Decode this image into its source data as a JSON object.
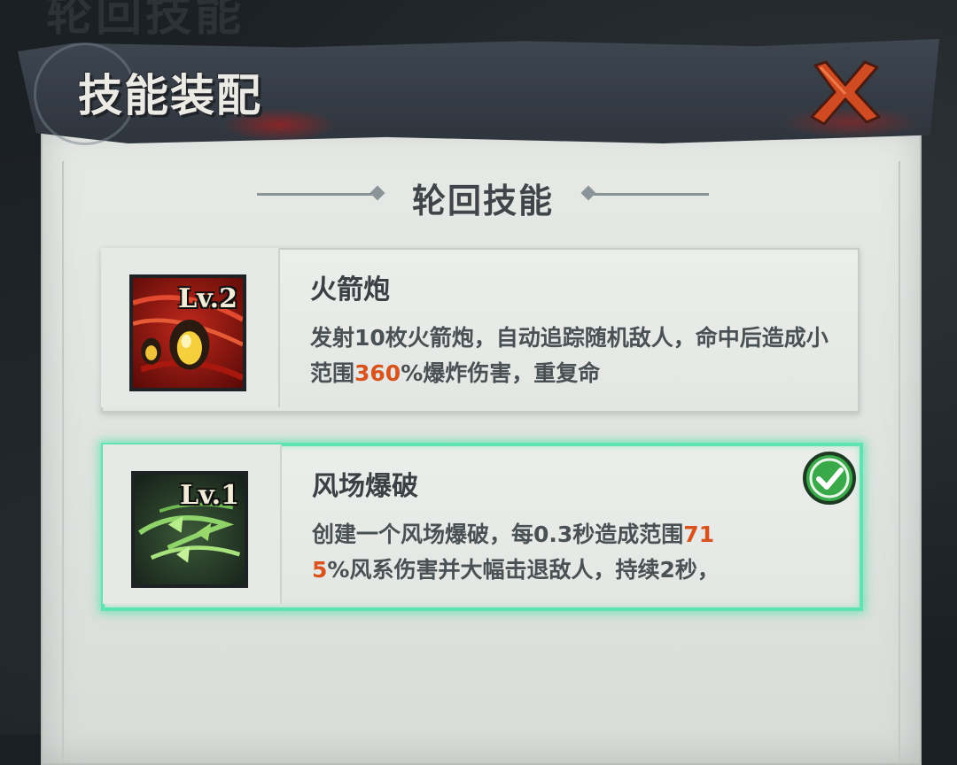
{
  "background": {
    "ghost_title": "轮回技能"
  },
  "header": {
    "title": "技能装配",
    "close_icon": "close-x-icon"
  },
  "section": {
    "title": "轮回技能"
  },
  "colors": {
    "highlight": "#d9531f",
    "selected_glow": "#5fe3b0",
    "check_green": "#3aa94a"
  },
  "skills": [
    {
      "name": "火箭炮",
      "level": "Lv.2",
      "icon": "rocket-bomb-icon",
      "desc_a": "发射10枚火箭炮，自动追踪随机敌人，命中后造成小范围",
      "desc_hl": "360",
      "desc_b": "%爆炸伤害，重复命",
      "selected": false
    },
    {
      "name": "风场爆破",
      "level": "Lv.1",
      "icon": "wind-blast-icon",
      "desc_a": "创建一个风场爆破，每0.3秒造成范围",
      "desc_hl_1": "71",
      "desc_hl_2": "5",
      "desc_b": "%风系伤害并大幅击退敌人，持续2秒，",
      "selected": true
    }
  ]
}
